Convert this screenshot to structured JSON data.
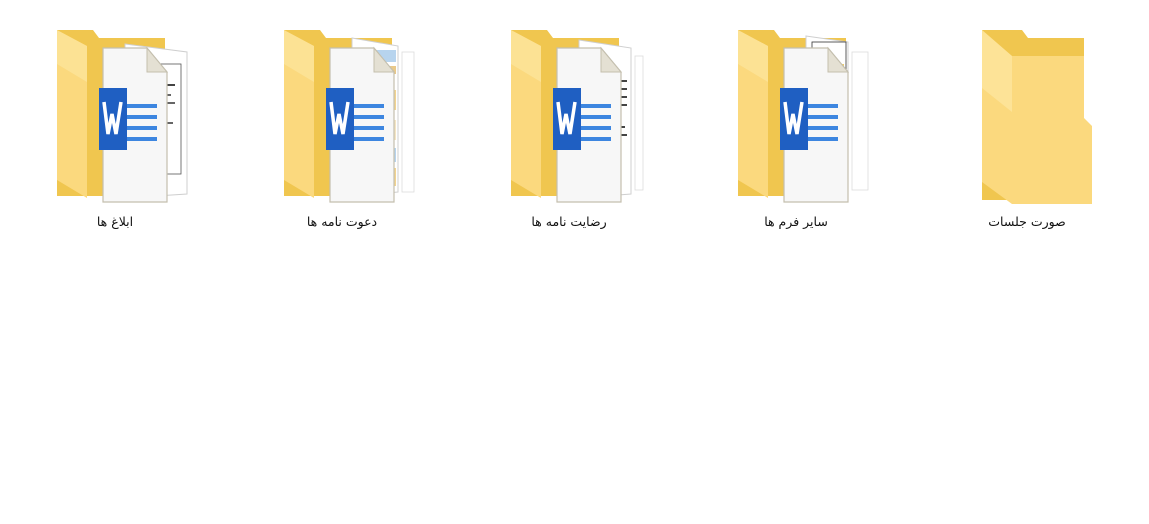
{
  "explorer": {
    "items": [
      {
        "label": "ابلاغ ها",
        "type": "folder-with-documents",
        "icon": "folder-word-documents-icon",
        "preview": "notice-doc"
      },
      {
        "label": "دعوت نامه ها",
        "type": "folder-with-documents",
        "icon": "folder-word-documents-icon",
        "preview": "invitation-doc"
      },
      {
        "label": "رضایت نامه ها",
        "type": "folder-with-documents",
        "icon": "folder-word-documents-icon",
        "preview": "consent-doc"
      },
      {
        "label": "سایر فرم ها",
        "type": "folder-with-documents",
        "icon": "folder-word-documents-icon",
        "preview": "form-doc"
      },
      {
        "label": "صورت جلسات",
        "type": "empty-folder",
        "icon": "folder-icon"
      }
    ]
  },
  "colors": {
    "folder_back": "#f0c64f",
    "folder_front": "#fbd97e",
    "folder_front_light": "#fde7a3",
    "word_blue": "#1f5fc2",
    "word_lines": "#3d86e0",
    "background": "#ffffff"
  }
}
